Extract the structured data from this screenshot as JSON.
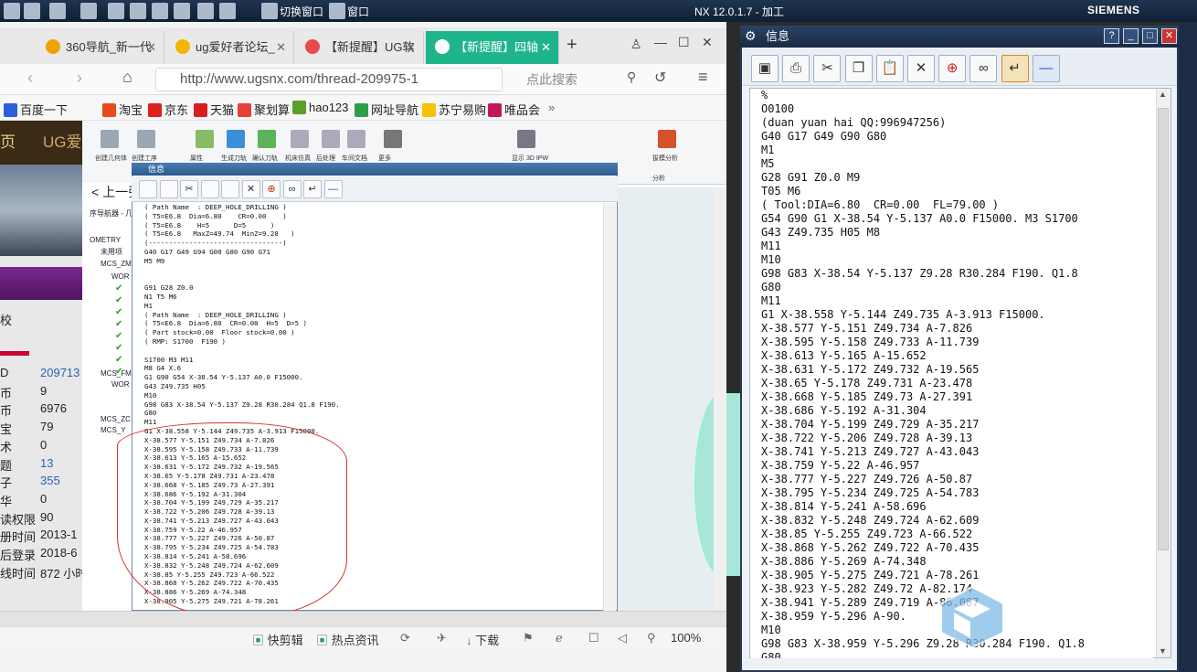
{
  "nx": {
    "title": "NX 12.0.1.7 - 加工",
    "brand": "SIEMENS",
    "switch_window": "切换窗口",
    "window_menu": "窗口"
  },
  "browser": {
    "tabs": [
      {
        "label": "360导航_新一代",
        "icon_color": "#f2a200"
      },
      {
        "label": "ug爱好者论坛_",
        "icon_color": "#f5b400"
      },
      {
        "label": "【新提醒】UG软",
        "icon_color": "#e64a4a"
      },
      {
        "label": "【新提醒】四轴",
        "icon_color": "#ffffff"
      }
    ],
    "url": "http://www.ugsnx.com/thread-209975-1",
    "search_placeholder": "点此搜索",
    "bookmarks": [
      {
        "label": "百度一下",
        "color": "#2c5fd8"
      },
      {
        "label": "淘宝",
        "color": "#e84b1a"
      },
      {
        "label": "京东",
        "color": "#e01f1f"
      },
      {
        "label": "天猫",
        "color": "#d81e1e"
      },
      {
        "label": "聚划算",
        "color": "#e6403b"
      },
      {
        "label": "hao123",
        "color": "#5b9e2c"
      },
      {
        "label": "网址导航",
        "color": "#2c9e4a"
      },
      {
        "label": "苏宁易购",
        "color": "#f3c300"
      },
      {
        "label": "唯品会",
        "color": "#c2185b"
      }
    ],
    "status": {
      "clip": "快剪辑",
      "news": "热点资讯",
      "download": "下载",
      "zoom": "100%"
    }
  },
  "forum": {
    "banner_text": "页",
    "banner_tail": "UG爱",
    "school": "校",
    "rows": [
      {
        "k": "D",
        "v": "209713",
        "blue": true
      },
      {
        "k": "币",
        "v": "9",
        "blue": false
      },
      {
        "k": "币",
        "v": "6976",
        "blue": false
      },
      {
        "k": "宝",
        "v": "79",
        "blue": false
      },
      {
        "k": "术",
        "v": "0",
        "blue": false
      },
      {
        "k": "题",
        "v": "13",
        "blue": true
      },
      {
        "k": "子",
        "v": "355",
        "blue": true
      },
      {
        "k": "华",
        "v": "0",
        "blue": false
      },
      {
        "k": "读权限",
        "v": "90",
        "blue": false
      },
      {
        "k": "册时间",
        "v": "2013-1",
        "blue": false
      },
      {
        "k": "后登录",
        "v": "2018-6",
        "blue": false
      },
      {
        "k": "线时间",
        "v": "872 小时",
        "blue": false
      }
    ]
  },
  "nx_inner": {
    "back": "上一张",
    "nav_items": [
      "序导航器 - 几",
      "OMETRY",
      "未用项",
      "MCS_ZM",
      "WOR",
      "MCS_FM",
      "WOR",
      "MCS_ZC",
      "MCS_Y"
    ],
    "ribbon": [
      "创建几何体",
      "创建工序",
      "属性",
      "生成刀轨",
      "确认刀轨",
      "机床仿真",
      "后处理",
      "车间文档",
      "更多",
      "显示 3D IPW",
      "拔模分析",
      "分析"
    ],
    "title": "信息",
    "text": "( Path Name  : DEEP_HOLE_DRILLING )\n( T5=E6.8  Dia=6.80    CR=0.00    )\n( T5=E6.8    H=5      D=5      )\n( T5=E6.8   MaxZ=49.74  MinZ=9.28   )\n(---------------------------------)\nG40 G17 G49 G94 G00 G80 G90 G71\nM5 M9\n\n\nG91 G28 Z0.0\nN1 T5 M6\nM1\n( Path Name  : DEEP_HOLE_DRILLING )\n( T5=E6.8  Dia=6.80  CR=0.00  H=5  D=5 )\n( Part stock=0.00  Floor stock=0.00 )\n( RMP: S1700  F190 )\n\nS1700 M3 M11\nM8 G4 X.6\nG1 G90 G54 X-38.54 Y-5.137 A0.0 F15000.\nG43 Z49.735 H05\nM10\nG98 G83 X-38.54 Y-5.137 Z9.28 R30.284 Q1.8 F190.\nG80\nM11\nG1 X-38.558 Y-5.144 Z49.735 A-3.913 F15000.\nX-38.577 Y-5.151 Z49.734 A-7.826\nX-38.595 Y-5.158 Z49.733 A-11.739\nX-38.613 Y-5.165 A-15.652\nX-38.631 Y-5.172 Z49.732 A-19.565\nX-38.65 Y-5.178 Z49.731 A-23.478\nX-38.668 Y-5.185 Z49.73 A-27.391\nX-38.686 Y-5.192 A-31.304\nX-38.704 Y-5.199 Z49.729 A-35.217\nX-38.722 Y-5.206 Z49.728 A-39.13\nX-38.741 Y-5.213 Z49.727 A-43.043\nX-38.759 Y-5.22 A-46.957\nX-38.777 Y-5.227 Z49.726 A-50.87\nX-38.795 Y-5.234 Z49.725 A-54.783\nX-38.814 Y-5.241 A-58.696\nX-38.832 Y-5.248 Z49.724 A-62.609\nX-38.85 Y-5.255 Z49.723 A-66.522\nX-38.868 Y-5.262 Z49.722 A-70.435\nX-38.886 Y-5.269 A-74.348\nX-38.905 Y-5.275 Z49.721 A-78.261"
  },
  "info": {
    "title": "信息",
    "text": "%\nO0100\n(duan yuan hai QQ:996947256)\nG40 G17 G49 G90 G80\nM1\nM5\nG28 G91 Z0.0 M9\nT05 M6\n( Tool:DIA=6.80  CR=0.00  FL=79.00 )\nG54 G90 G1 X-38.54 Y-5.137 A0.0 F15000. M3 S1700\nG43 Z49.735 H05 M8\nM11\nM10\nG98 G83 X-38.54 Y-5.137 Z9.28 R30.284 F190. Q1.8\nG80\nM11\nG1 X-38.558 Y-5.144 Z49.735 A-3.913 F15000.\nX-38.577 Y-5.151 Z49.734 A-7.826\nX-38.595 Y-5.158 Z49.733 A-11.739\nX-38.613 Y-5.165 A-15.652\nX-38.631 Y-5.172 Z49.732 A-19.565\nX-38.65 Y-5.178 Z49.731 A-23.478\nX-38.668 Y-5.185 Z49.73 A-27.391\nX-38.686 Y-5.192 A-31.304\nX-38.704 Y-5.199 Z49.729 A-35.217\nX-38.722 Y-5.206 Z49.728 A-39.13\nX-38.741 Y-5.213 Z49.727 A-43.043\nX-38.759 Y-5.22 A-46.957\nX-38.777 Y-5.227 Z49.726 A-50.87\nX-38.795 Y-5.234 Z49.725 A-54.783\nX-38.814 Y-5.241 A-58.696\nX-38.832 Y-5.248 Z49.724 A-62.609\nX-38.85 Y-5.255 Z49.723 A-66.522\nX-38.868 Y-5.262 Z49.722 A-70.435\nX-38.886 Y-5.269 A-74.348\nX-38.905 Y-5.275 Z49.721 A-78.261\nX-38.923 Y-5.282 Z49.72 A-82.174\nX-38.941 Y-5.289 Z49.719 A-86.087\nX-38.959 Y-5.296 A-90.\nM10\nG98 G83 X-38.959 Y-5.296 Z9.28 R30.284 F190. Q1.8\nG80"
  }
}
